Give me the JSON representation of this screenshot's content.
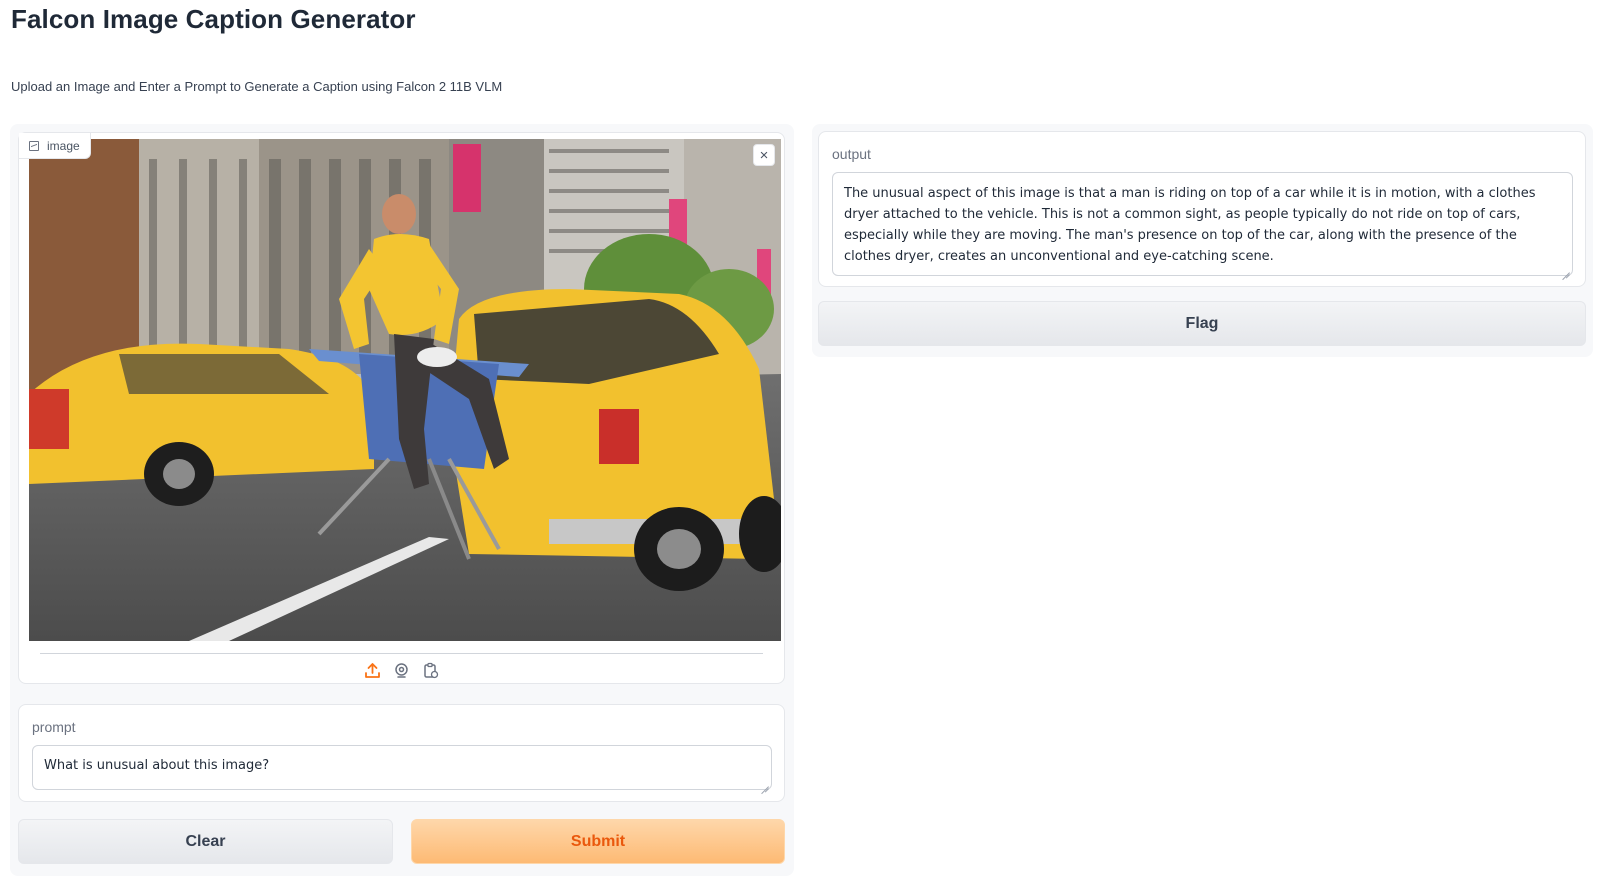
{
  "app": {
    "title": "Falcon Image Caption Generator",
    "description": "Upload an Image and Enter a Prompt to Generate a Caption using Falcon 2 11B VLM"
  },
  "image_input": {
    "label": "image",
    "close_symbol": "×",
    "tools": [
      "upload-icon",
      "webcam-icon",
      "clipboard-icon"
    ],
    "accent_color": "#f97316"
  },
  "prompt": {
    "label": "prompt",
    "value": "What is unusual about this image?"
  },
  "buttons": {
    "clear": "Clear",
    "submit": "Submit",
    "flag": "Flag"
  },
  "output": {
    "label": "output",
    "value": "The unusual aspect of this image is that a man is riding on top of a car while it is in motion, with a clothes dryer attached to the vehicle. This is not a common sight, as people typically do not ride on top of cars, especially while they are moving. The man's presence on top of the car, along with the presence of the clothes dryer, creates an unconventional and eye-catching scene."
  }
}
